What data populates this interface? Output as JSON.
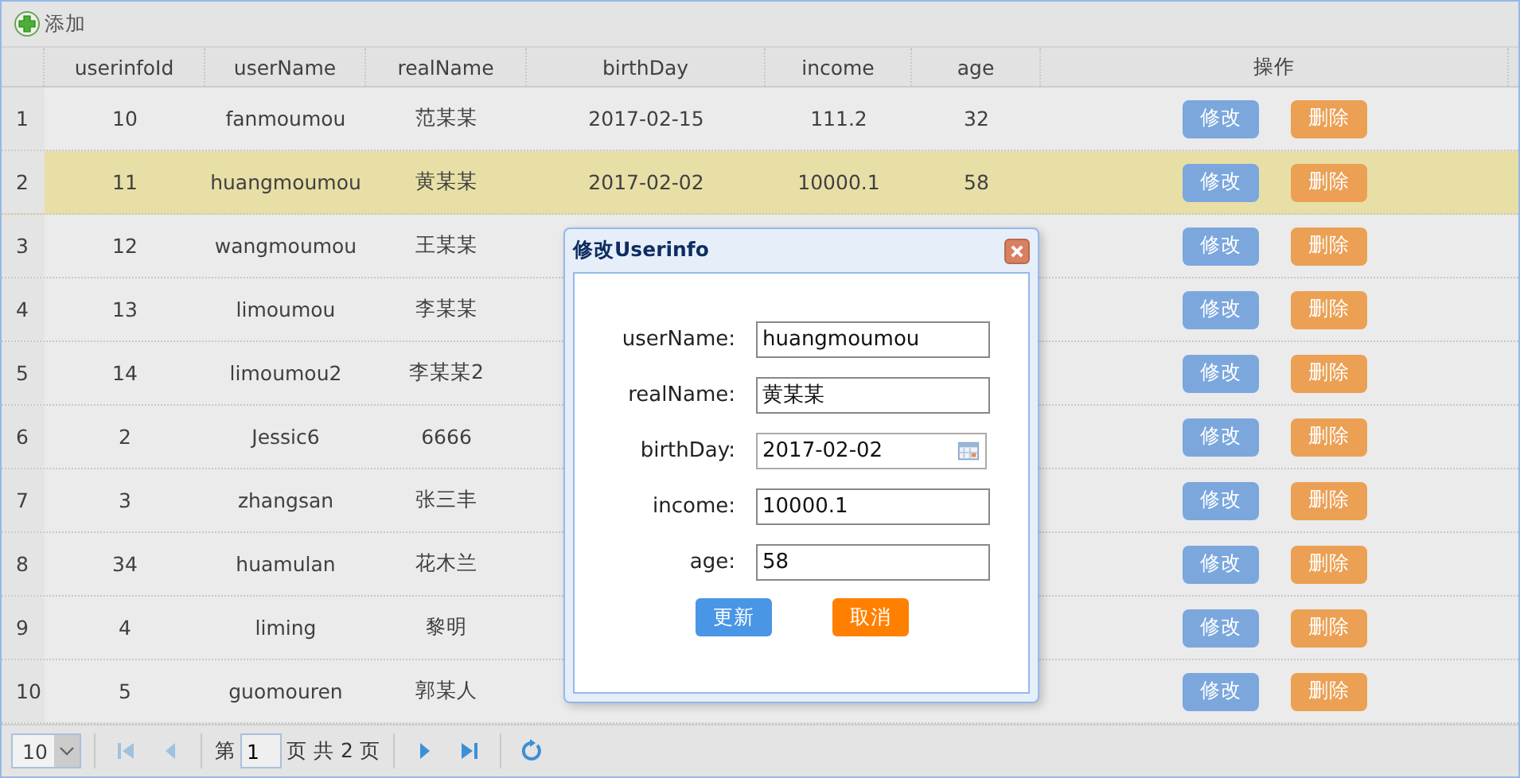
{
  "toolbar": {
    "add_button": "添加"
  },
  "table": {
    "columns": [
      "userinfoId",
      "userName",
      "realName",
      "birthDay",
      "income",
      "age",
      "操作"
    ],
    "rows": [
      {
        "number": "1",
        "selected": false,
        "cells": [
          "10",
          "fanmoumou",
          "范某某",
          "2017-02-15",
          "111.2",
          "32"
        ],
        "actions": [
          "修改",
          "删除"
        ]
      },
      {
        "number": "2",
        "selected": true,
        "cells": [
          "11",
          "huangmoumou",
          "黄某某",
          "2017-02-02",
          "10000.1",
          "58"
        ],
        "actions": [
          "修改",
          "删除"
        ]
      },
      {
        "number": "3",
        "selected": false,
        "cells": [
          "12",
          "wangmoumou",
          "王某某"
        ],
        "actions": [
          "修改",
          "删除"
        ]
      },
      {
        "number": "4",
        "selected": false,
        "cells": [
          "13",
          "limoumou",
          "李某某"
        ],
        "actions": [
          "修改",
          "删除"
        ]
      },
      {
        "number": "5",
        "selected": false,
        "cells": [
          "14",
          "limoumou2",
          "李某某2"
        ],
        "actions": [
          "修改",
          "删除"
        ]
      },
      {
        "number": "6",
        "selected": false,
        "cells": [
          "2",
          "Jessic6",
          "6666"
        ],
        "actions": [
          "修改",
          "删除"
        ]
      },
      {
        "number": "7",
        "selected": false,
        "cells": [
          "3",
          "zhangsan",
          "张三丰"
        ],
        "actions": [
          "修改",
          "删除"
        ]
      },
      {
        "number": "8",
        "selected": false,
        "cells": [
          "34",
          "huamulan",
          "花木兰"
        ],
        "actions": [
          "修改",
          "删除"
        ]
      },
      {
        "number": "9",
        "selected": false,
        "cells": [
          "4",
          "liming",
          "黎明"
        ],
        "actions": [
          "修改",
          "删除"
        ]
      },
      {
        "number": "10",
        "selected": false,
        "cells": [
          "5",
          "guomouren",
          "郭某人"
        ],
        "actions": [
          "修改",
          "删除"
        ]
      }
    ]
  },
  "pager": {
    "page_size": "10",
    "first_disabled": true,
    "prev_disabled": true,
    "page_prefix": "第",
    "page_input": "1",
    "page_suffix": "页 共 2 页"
  },
  "dialog": {
    "title": "修改Userinfo",
    "fields": [
      {
        "kind": "text",
        "label": "userName:",
        "value": "huangmoumou"
      },
      {
        "kind": "text",
        "label": "realName:",
        "value": "黄某某"
      },
      {
        "kind": "date",
        "label": "birthDay:",
        "value": "2017-02-02"
      },
      {
        "kind": "text",
        "label": "income:",
        "value": "10000.1"
      },
      {
        "kind": "text",
        "label": "age:",
        "value": "58"
      }
    ],
    "buttons": [
      {
        "kind": "primary",
        "label": "更新"
      },
      {
        "kind": "cancel",
        "label": "取消"
      }
    ]
  }
}
